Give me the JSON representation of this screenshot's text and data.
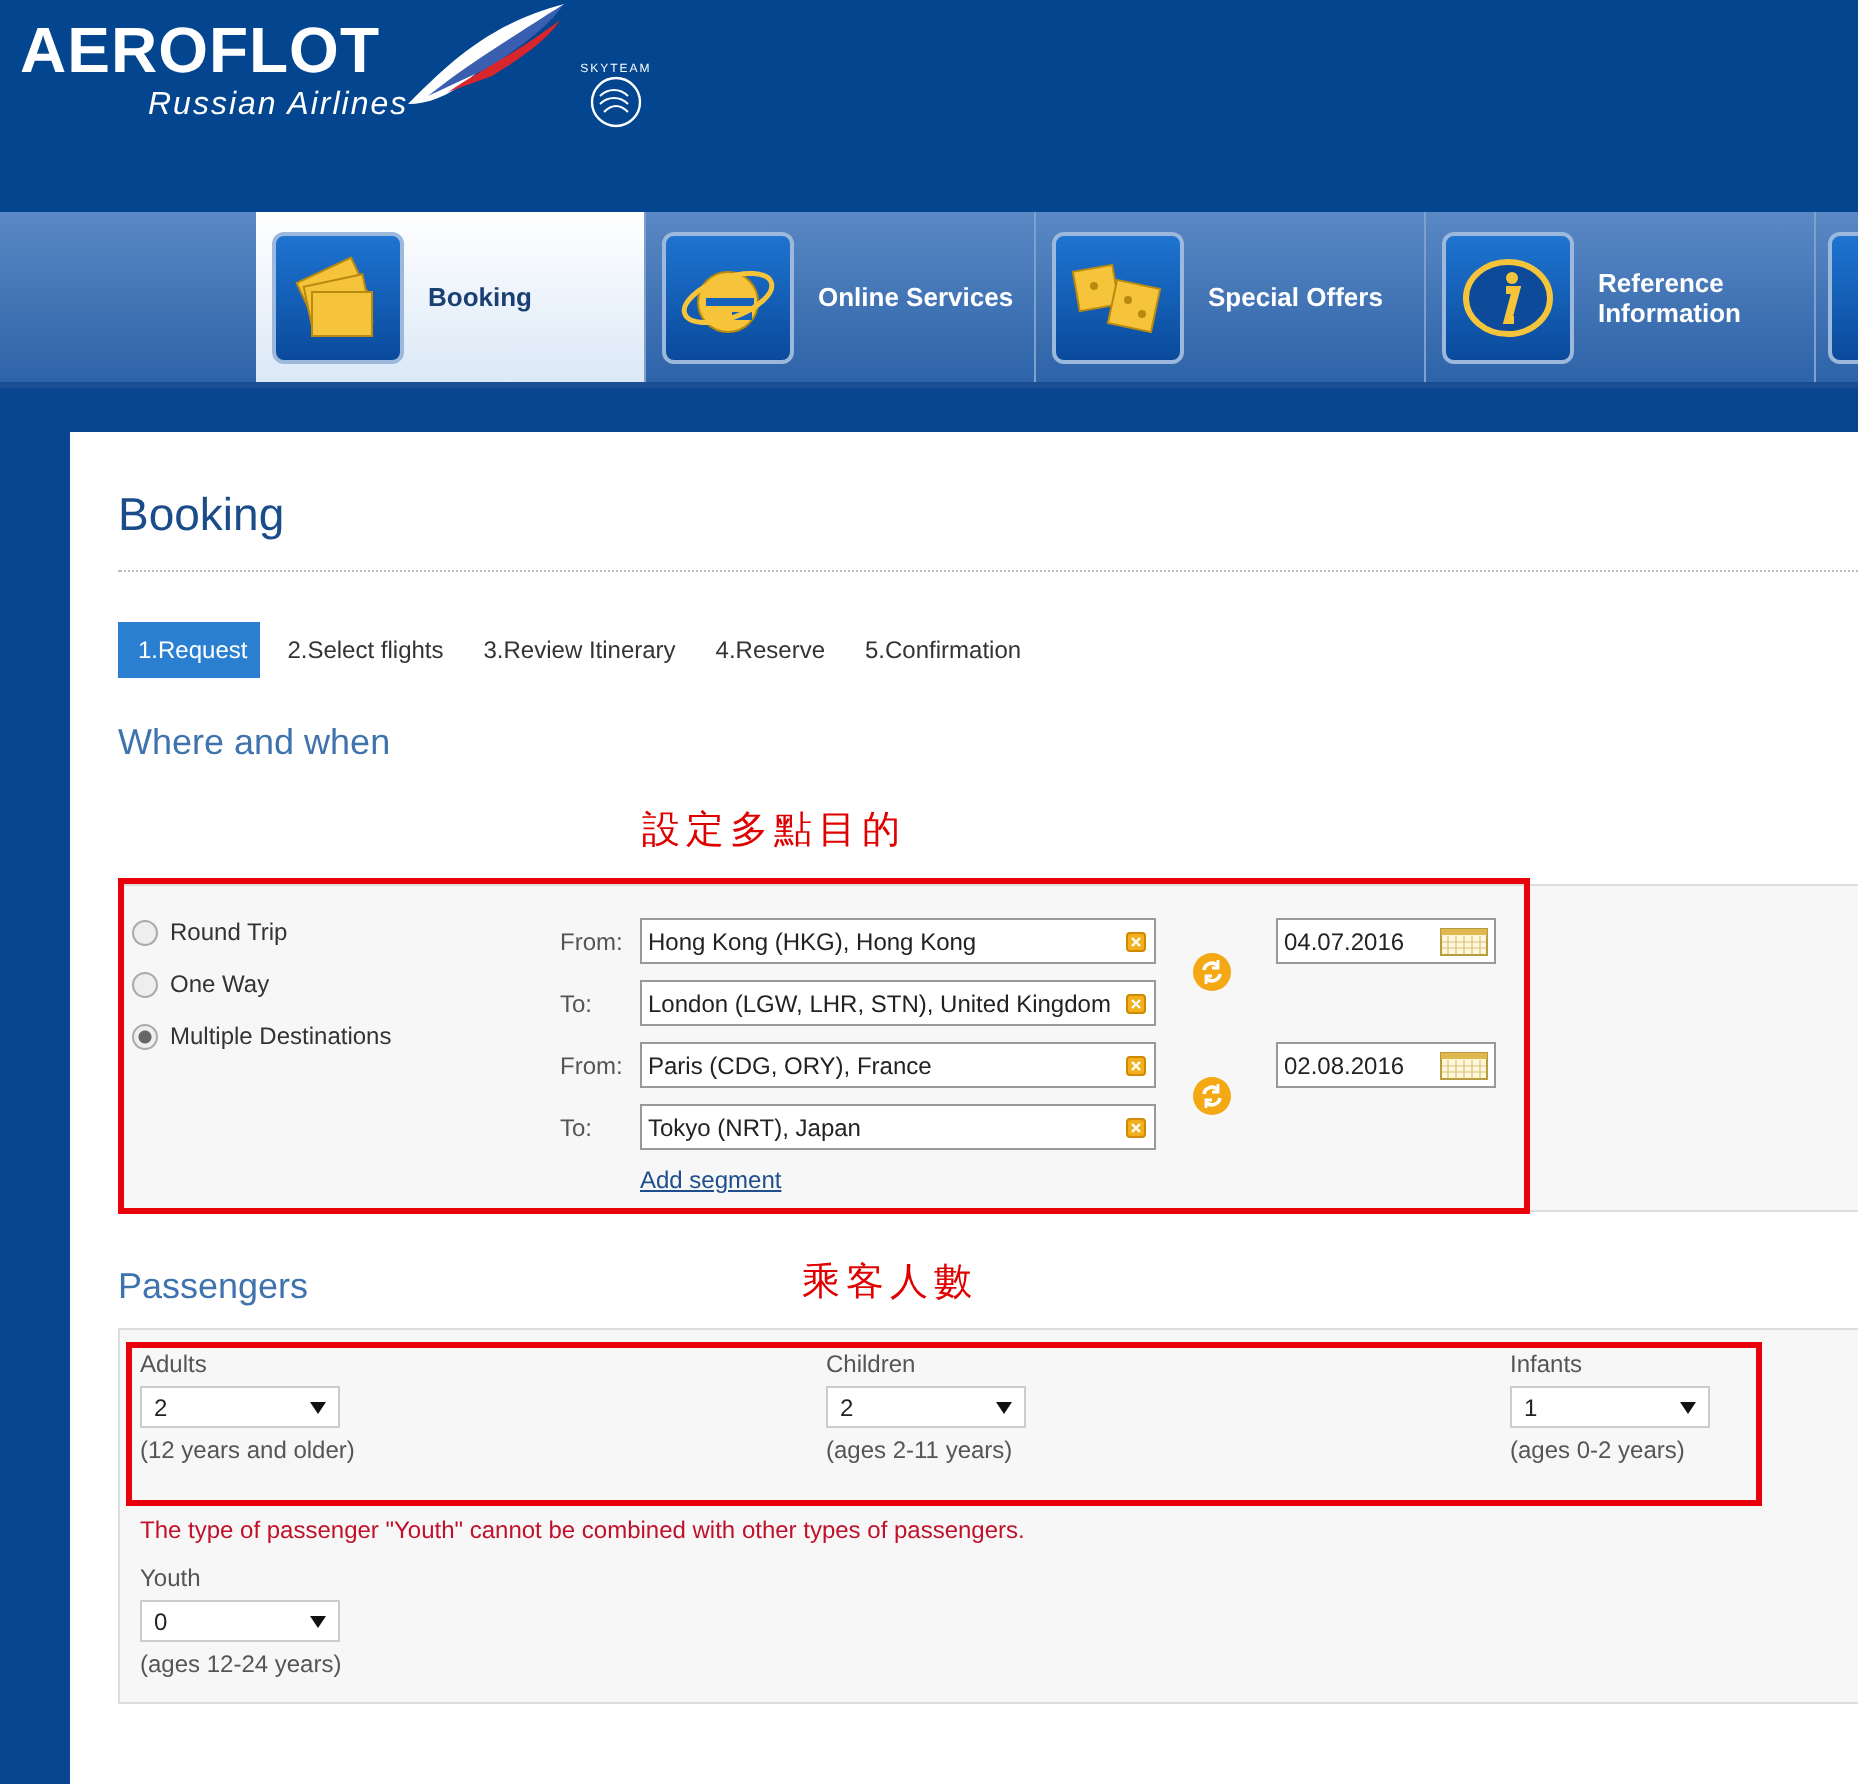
{
  "header": {
    "logo": "AEROFLOT",
    "tagline": "Russian Airlines",
    "alliance": "SKYTEAM"
  },
  "nav": [
    {
      "label": "Booking",
      "kind": "tickets",
      "selected": true
    },
    {
      "label": "Online Services",
      "kind": "browser",
      "selected": false
    },
    {
      "label": "Special Offers",
      "kind": "dice",
      "selected": false
    },
    {
      "label": "Reference Information",
      "kind": "info",
      "selected": false
    }
  ],
  "page_title": "Booking",
  "steps": [
    {
      "label": "1.Request",
      "selected": true
    },
    {
      "label": "2.Select flights",
      "selected": false
    },
    {
      "label": "3.Review Itinerary",
      "selected": false
    },
    {
      "label": "4.Reserve",
      "selected": false
    },
    {
      "label": "5.Confirmation",
      "selected": false
    }
  ],
  "where_and_when": {
    "heading": "Where and when",
    "annotation": "設定多點目的",
    "trip_types": [
      {
        "label": "Round Trip",
        "selected": false
      },
      {
        "label": "One Way",
        "selected": false
      },
      {
        "label": "Multiple Destinations",
        "selected": true
      }
    ],
    "segments": [
      {
        "from_label": "From:",
        "from": "Hong Kong (HKG), Hong Kong",
        "to_label": "To:",
        "to": "London (LGW, LHR, STN), United Kingdom",
        "date": "04.07.2016"
      },
      {
        "from_label": "From:",
        "from": "Paris (CDG, ORY), France",
        "to_label": "To:",
        "to": "Tokyo (NRT), Japan",
        "date": "02.08.2016"
      }
    ],
    "add_segment": "Add segment"
  },
  "passengers": {
    "heading": "Passengers",
    "annotation": "乘客人數",
    "types": [
      {
        "label": "Adults",
        "value": "2",
        "hint": "(12 years and older)"
      },
      {
        "label": "Children",
        "value": "2",
        "hint": "(ages 2-11 years)"
      },
      {
        "label": "Infants",
        "value": "1",
        "hint": "(ages 0-2 years)"
      }
    ],
    "error": "The type of passenger \"Youth\" cannot be combined with other types of passengers.",
    "youth": {
      "label": "Youth",
      "value": "0",
      "hint": "(ages 12-24 years)"
    }
  }
}
